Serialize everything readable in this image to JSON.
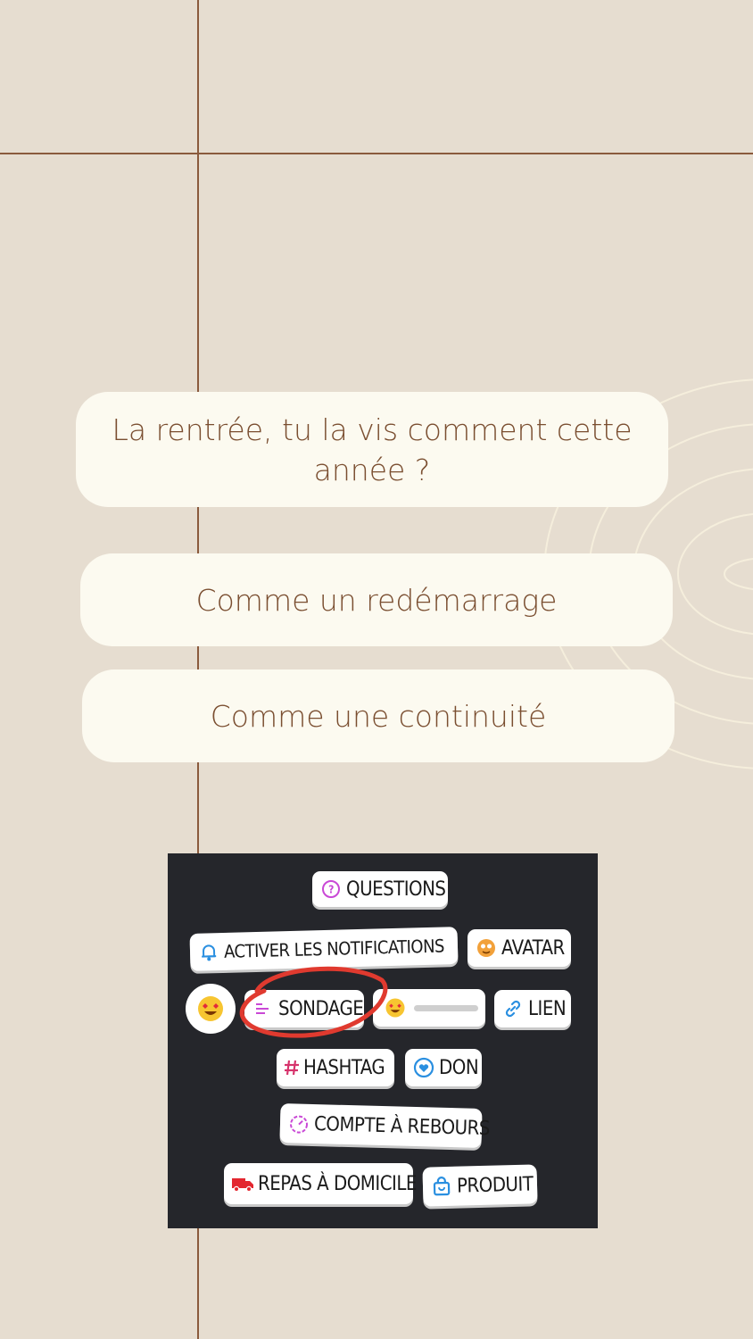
{
  "colors": {
    "background": "#e6ddd0",
    "line": "#8a5a3c",
    "card": "#fcfaf0",
    "card_text": "#7a4e30",
    "panel": "#25262b",
    "highlight_oval": "#e03a2f"
  },
  "poll": {
    "question": "La rentrée, tu la vis comment cette année ?",
    "options": [
      "Comme un redémarrage",
      "Comme une continuité"
    ]
  },
  "stickers": {
    "questions": {
      "label": "QUESTIONS",
      "icon": "question-bubble-icon"
    },
    "notifications": {
      "label": "ACTIVER LES NOTIFICATIONS",
      "icon": "bell-icon"
    },
    "avatar": {
      "label": "AVATAR",
      "icon": "avatar-face-icon"
    },
    "emoji": {
      "icon": "heart-eyes-emoji-icon"
    },
    "sondage": {
      "label": "SONDAGE",
      "icon": "poll-bars-icon"
    },
    "slider": {
      "icon": "heart-eyes-emoji-icon"
    },
    "lien": {
      "label": "LIEN",
      "icon": "link-icon"
    },
    "hashtag": {
      "label": "HASHTAG",
      "icon": "hash-icon"
    },
    "don": {
      "label": "DON",
      "icon": "heart-donation-icon"
    },
    "countdown": {
      "label": "COMPTE À REBOURS",
      "icon": "timer-icon"
    },
    "repas": {
      "label": "REPAS À DOMICILE",
      "icon": "delivery-truck-icon"
    },
    "produit": {
      "label": "PRODUIT",
      "icon": "shopping-bag-icon"
    }
  }
}
